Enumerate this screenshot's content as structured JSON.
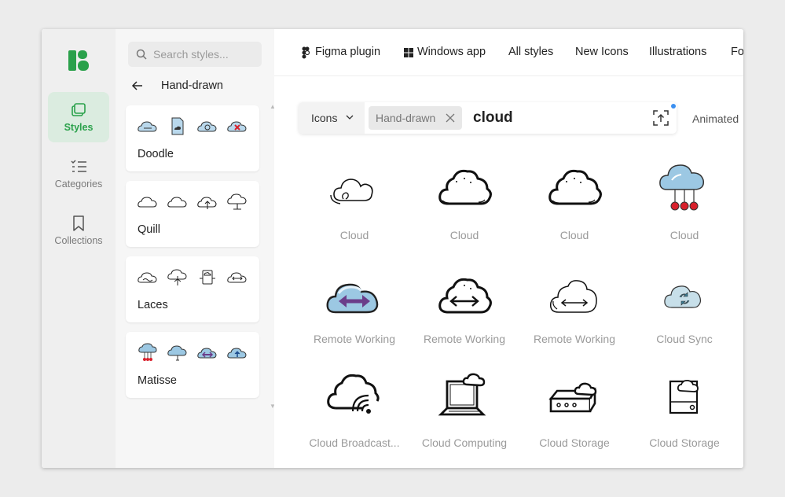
{
  "rail": {
    "items": [
      {
        "label": "Styles",
        "icon": "styles-icon",
        "active": true
      },
      {
        "label": "Categories",
        "icon": "categories-icon",
        "active": false
      },
      {
        "label": "Collections",
        "icon": "bookmark-icon",
        "active": false
      }
    ]
  },
  "panel": {
    "search_placeholder": "Search styles...",
    "back_label": "Hand-drawn",
    "cards": [
      {
        "label": "Doodle"
      },
      {
        "label": "Quill"
      },
      {
        "label": "Laces"
      },
      {
        "label": "Matisse"
      }
    ]
  },
  "nav": {
    "items": [
      "Figma plugin",
      "Windows app",
      "All styles",
      "New Icons",
      "Illustrations",
      "Fo"
    ]
  },
  "searchbar": {
    "type": "Icons",
    "chip": "Hand-drawn",
    "query": "cloud",
    "animated": "Animated"
  },
  "results": [
    {
      "label": "Cloud"
    },
    {
      "label": "Cloud"
    },
    {
      "label": "Cloud"
    },
    {
      "label": "Cloud"
    },
    {
      "label": "Remote Working"
    },
    {
      "label": "Remote Working"
    },
    {
      "label": "Remote Working"
    },
    {
      "label": "Cloud Sync"
    },
    {
      "label": "Cloud Broadcast..."
    },
    {
      "label": "Cloud Computing"
    },
    {
      "label": "Cloud Storage"
    },
    {
      "label": "Cloud Storage"
    }
  ],
  "colors": {
    "accent": "#2aa14b",
    "accent_bg": "#dbece0",
    "cloud_blue": "#9cc8e3",
    "purple": "#6b3d8a",
    "red": "#d8202b"
  }
}
